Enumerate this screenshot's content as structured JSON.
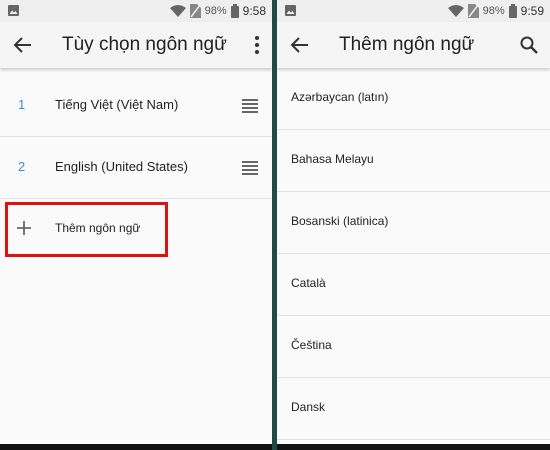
{
  "left_screen": {
    "status": {
      "battery_pct": "98%",
      "time": "9:58"
    },
    "appbar": {
      "title": "Tùy chọn ngôn ngữ"
    },
    "languages": [
      {
        "index": "1",
        "name": "Tiếng Việt (Việt Nam)"
      },
      {
        "index": "2",
        "name": "English (United States)"
      }
    ],
    "add_language_label": "Thêm ngôn ngữ"
  },
  "right_screen": {
    "status": {
      "battery_pct": "98%",
      "time": "9:59"
    },
    "appbar": {
      "title": "Thêm ngôn ngữ"
    },
    "languages": [
      "Azərbaycan (latın)",
      "Bahasa Melayu",
      "Bosanski (latinica)",
      "Català",
      "Čeština",
      "Dansk"
    ]
  },
  "colors": {
    "accent_number": "#3b8cd9",
    "highlight_box": "#e01010",
    "divider": "#1f4a4a"
  }
}
